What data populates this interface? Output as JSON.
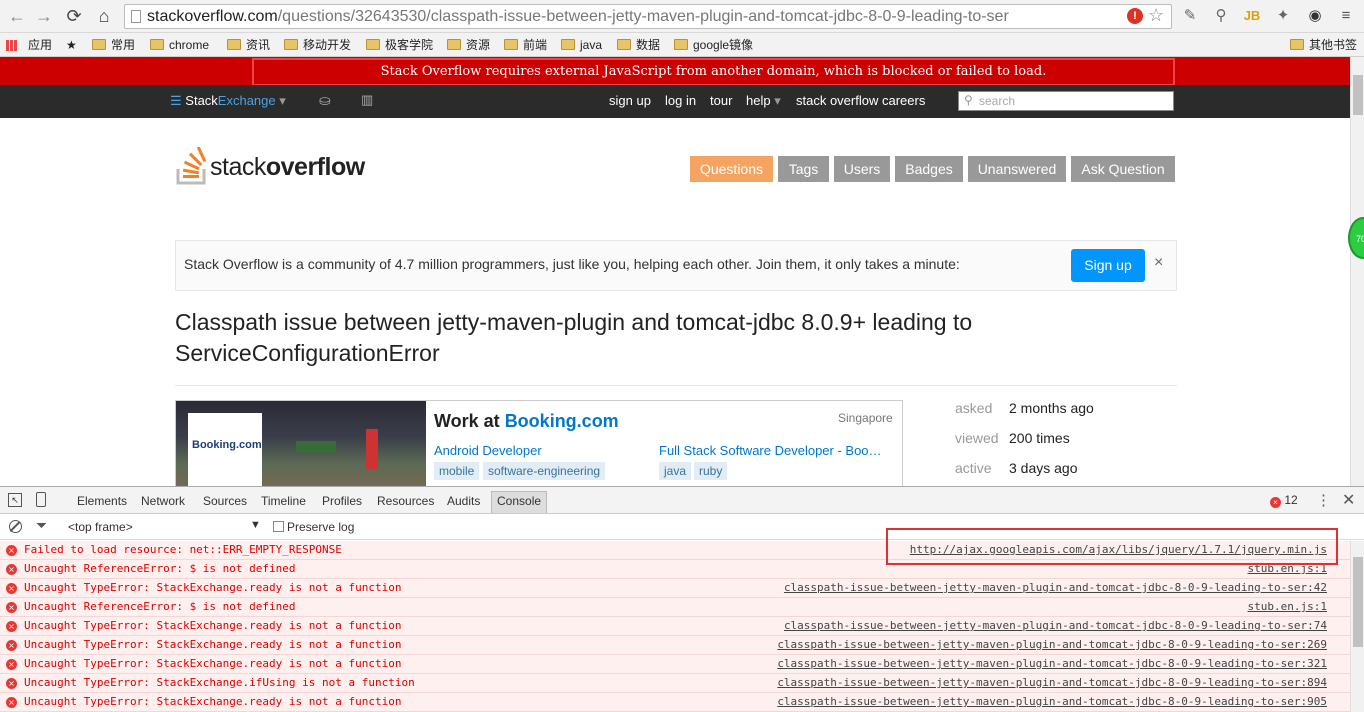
{
  "browser": {
    "url_host": "stackoverflow.com",
    "url_path": "/questions/32643530/classpath-issue-between-jetty-maven-plugin-and-tomcat-jdbc-8-0-9-leading-to-ser",
    "bookmarks": [
      "应用",
      "常用",
      "chrome",
      "资讯",
      "移动开发",
      "极客学院",
      "资源",
      "前端",
      "java",
      "数据",
      "google镜像",
      "其他书签"
    ]
  },
  "page": {
    "noscript_warning": "Stack Overflow requires external JavaScript from another domain, which is blocked or failed to load.",
    "topbar": {
      "brand_a": "Stack",
      "brand_b": "Exchange",
      "links": [
        "sign up",
        "log in",
        "tour",
        "help",
        "stack overflow careers"
      ],
      "search_placeholder": "search"
    },
    "logo_a": "stack",
    "logo_b": "overflow",
    "nav": [
      "Questions",
      "Tags",
      "Users",
      "Badges",
      "Unanswered",
      "Ask Question"
    ],
    "welcome": {
      "text": "Stack Overflow is a community of 4.7 million programmers, just like you, helping each other. Join them, it only takes a minute:",
      "button": "Sign up",
      "close": "×"
    },
    "question_title": "Classpath issue between jetty-maven-plugin and tomcat-jdbc 8.0.9+ leading to ServiceConfigurationError",
    "ad": {
      "logo": "Booking.com",
      "heading_a": "Work at ",
      "heading_b": "Booking.com",
      "location": "Singapore",
      "job1": "Android Developer",
      "job1_tags": [
        "mobile",
        "software-engineering"
      ],
      "job2": "Full Stack Software Developer - Boo…",
      "job2_tags": [
        "java",
        "ruby"
      ]
    },
    "meta": [
      {
        "k": "asked",
        "v": "2 months ago"
      },
      {
        "k": "viewed",
        "v": "200 times"
      },
      {
        "k": "active",
        "v": "3 days ago"
      }
    ],
    "badge": "70"
  },
  "devtools": {
    "tabs": [
      "Elements",
      "Network",
      "Sources",
      "Timeline",
      "Profiles",
      "Resources",
      "Audits",
      "Console"
    ],
    "active_tab": "Console",
    "error_count": "12",
    "frame": "<top frame>",
    "preserve_log": "Preserve log",
    "messages": [
      {
        "msg": "Failed to load resource: net::ERR_EMPTY_RESPONSE",
        "src": "http://ajax.googleapis.com/ajax/libs/jquery/1.7.1/jquery.min.js"
      },
      {
        "msg": "Uncaught ReferenceError: $ is not defined",
        "src": "stub.en.js:1"
      },
      {
        "msg": "Uncaught TypeError: StackExchange.ready is not a function",
        "src": "classpath-issue-between-jetty-maven-plugin-and-tomcat-jdbc-8-0-9-leading-to-ser:42"
      },
      {
        "msg": "Uncaught ReferenceError: $ is not defined",
        "src": "stub.en.js:1"
      },
      {
        "msg": "Uncaught TypeError: StackExchange.ready is not a function",
        "src": "classpath-issue-between-jetty-maven-plugin-and-tomcat-jdbc-8-0-9-leading-to-ser:74"
      },
      {
        "msg": "Uncaught TypeError: StackExchange.ready is not a function",
        "src": "classpath-issue-between-jetty-maven-plugin-and-tomcat-jdbc-8-0-9-leading-to-ser:269"
      },
      {
        "msg": "Uncaught TypeError: StackExchange.ready is not a function",
        "src": "classpath-issue-between-jetty-maven-plugin-and-tomcat-jdbc-8-0-9-leading-to-ser:321"
      },
      {
        "msg": "Uncaught TypeError: StackExchange.ifUsing is not a function",
        "src": "classpath-issue-between-jetty-maven-plugin-and-tomcat-jdbc-8-0-9-leading-to-ser:894"
      },
      {
        "msg": "Uncaught TypeError: StackExchange.ready is not a function",
        "src": "classpath-issue-between-jetty-maven-plugin-and-tomcat-jdbc-8-0-9-leading-to-ser:905"
      }
    ]
  },
  "colors": {
    "so_orange": "#f48024",
    "nav_active": "#f4a460",
    "error_red": "#cc0000",
    "link_blue": "#0077cc"
  }
}
